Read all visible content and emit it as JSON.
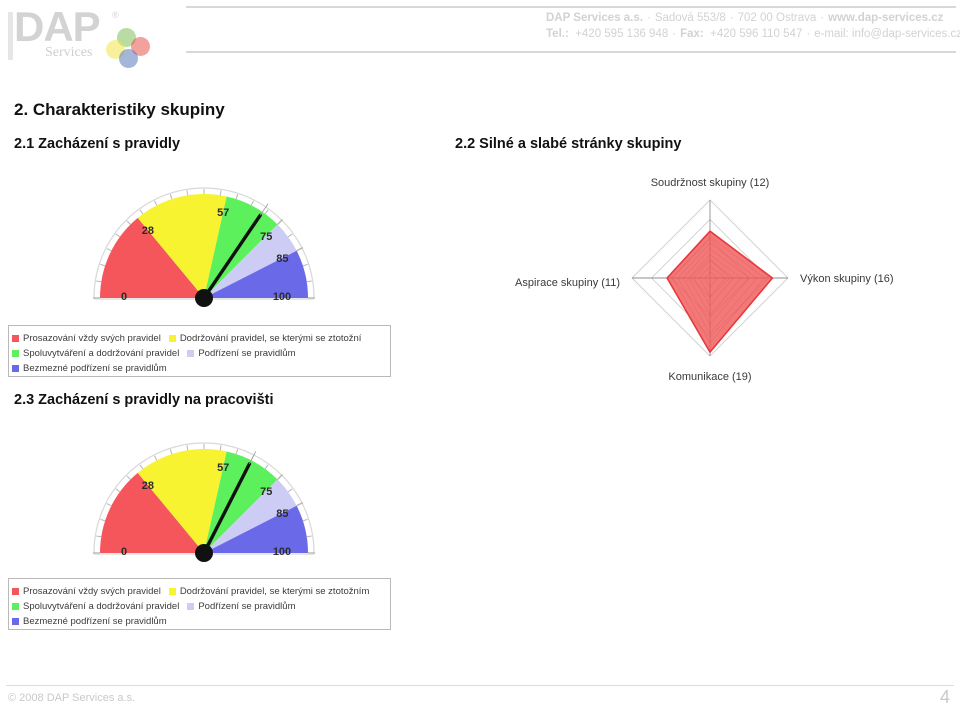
{
  "header": {
    "logo": {
      "wordmark": "DAP",
      "registered": "®",
      "subtitle": "Services"
    },
    "contact_line1_company": "DAP Services a.s.",
    "contact_line1_address": "Sadová 553/8",
    "contact_line1_city": "702 00 Ostrava",
    "contact_line1_web": "www.dap-services.cz",
    "contact_line2_tel_label": "Tel.:",
    "contact_line2_tel": "+420 595 136 948",
    "contact_line2_fax_label": "Fax:",
    "contact_line2_fax": "+420 596 110 547",
    "contact_line2_email": "e-mail: info@dap-services.cz",
    "separator": "·"
  },
  "headings": {
    "section": "2. Charakteristiky skupiny",
    "sub_2_1": "2.1 Zacházení s pravidly",
    "sub_2_2": "2.2 Silné a slabé stránky skupiny",
    "sub_2_3": "2.3 Zacházení s pravidly na pracovišti"
  },
  "footer": {
    "copyright": "© 2008 DAP Services a.s.",
    "page_number": "4"
  },
  "colors": {
    "band_red": "#f4565c",
    "band_yellow": "#f7f331",
    "band_green": "#5cf05c",
    "band_lavender": "#ccccf5",
    "band_blue": "#6a6ae8",
    "needle": "#111111",
    "radar_fill": "#f05a5a",
    "radar_stroke": "#e8383e",
    "grid": "#c9c9c9"
  },
  "chart_data": [
    {
      "type": "gauge",
      "id": "gauge-2-1",
      "title": "2.1 Zacházení s pravidly",
      "min": 0,
      "max": 100,
      "value": 69,
      "tick_labels": [
        "0",
        "28",
        "57",
        "75",
        "85",
        "100"
      ],
      "tick_values": [
        0,
        28,
        57,
        75,
        85,
        100
      ],
      "minor_tick_step": 5,
      "bands": [
        {
          "from": 0,
          "to": 28,
          "color": "#f4565c",
          "label": "Prosazování vždy svých pravidel"
        },
        {
          "from": 28,
          "to": 57,
          "color": "#f7f331",
          "label": "Dodržování pravidel, se kterými se ztotožní"
        },
        {
          "from": 57,
          "to": 75,
          "color": "#5cf05c",
          "label": "Spoluvytváření a dodržování pravidel"
        },
        {
          "from": 75,
          "to": 85,
          "color": "#ccccf5",
          "label": "Podřízení se pravidlům"
        },
        {
          "from": 85,
          "to": 100,
          "color": "#6a6ae8",
          "label": "Bezmezné podřízení se pravidlům"
        }
      ],
      "legend_rows": [
        [
          {
            "color": "#f4565c",
            "label": "Prosazování vždy svých pravidel"
          },
          {
            "color": "#f7f331",
            "label": "Dodržování pravidel, se kterými se ztotožní"
          }
        ],
        [
          {
            "color": "#5cf05c",
            "label": "Spoluvytváření a dodržování pravidel"
          },
          {
            "color": "#ccccf5",
            "label": "Podřízení se pravidlům"
          }
        ],
        [
          {
            "color": "#6a6ae8",
            "label": "Bezmezné podřízení se pravidlům"
          }
        ]
      ]
    },
    {
      "type": "radar",
      "id": "radar-2-2",
      "title": "2.2 Silné a slabé stránky skupiny",
      "axes": [
        {
          "label": "Soudržnost skupiny (12)",
          "value": 12,
          "position": "top"
        },
        {
          "label": "Výkon skupiny (16)",
          "value": 16,
          "position": "right"
        },
        {
          "label": "Komunikace (19)",
          "value": 19,
          "position": "bottom"
        },
        {
          "label": "Aspirace skupiny (11)",
          "value": 11,
          "position": "left"
        }
      ],
      "max": 20,
      "rings": 4,
      "fill_color": "#f05a5a",
      "stroke_color": "#e8383e"
    },
    {
      "type": "gauge",
      "id": "gauge-2-3",
      "title": "2.3 Zacházení s pravidly na pracovišti",
      "min": 0,
      "max": 100,
      "value": 65,
      "tick_labels": [
        "0",
        "28",
        "57",
        "75",
        "85",
        "100"
      ],
      "tick_values": [
        0,
        28,
        57,
        75,
        85,
        100
      ],
      "minor_tick_step": 5,
      "bands": [
        {
          "from": 0,
          "to": 28,
          "color": "#f4565c",
          "label": "Prosazování vždy svých pravidel"
        },
        {
          "from": 28,
          "to": 57,
          "color": "#f7f331",
          "label": "Dodržování pravidel, se kterými se ztotožním"
        },
        {
          "from": 57,
          "to": 75,
          "color": "#5cf05c",
          "label": "Spoluvytváření a dodržování pravidel"
        },
        {
          "from": 75,
          "to": 85,
          "color": "#ccccf5",
          "label": "Podřízení se pravidlům"
        },
        {
          "from": 85,
          "to": 100,
          "color": "#6a6ae8",
          "label": "Bezmezné podřízení se pravidlům"
        }
      ],
      "legend_rows": [
        [
          {
            "color": "#f4565c",
            "label": "Prosazování vždy svých pravidel"
          },
          {
            "color": "#f7f331",
            "label": "Dodržování pravidel, se kterými se ztotožním"
          }
        ],
        [
          {
            "color": "#5cf05c",
            "label": "Spoluvytváření a dodržování pravidel"
          },
          {
            "color": "#ccccf5",
            "label": "Podřízení se pravidlům"
          }
        ],
        [
          {
            "color": "#6a6ae8",
            "label": "Bezmezné podřízení se pravidlům"
          }
        ]
      ]
    }
  ]
}
